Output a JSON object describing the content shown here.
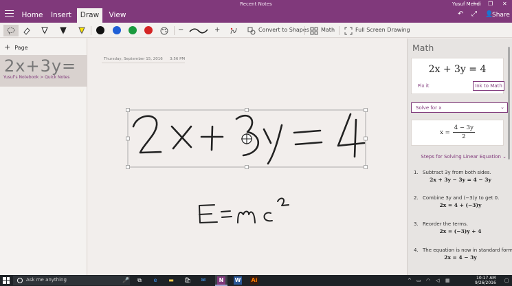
{
  "window": {
    "title": "Recent Notes",
    "user": "Yusuf Mehdi",
    "share_label": "Share",
    "share_icon": "person-share-icon"
  },
  "tabs": [
    {
      "label": "Home"
    },
    {
      "label": "Insert"
    },
    {
      "label": "Draw",
      "active": true
    },
    {
      "label": "View"
    }
  ],
  "ribbon": {
    "pen_colors": [
      "#111111",
      "#1f5fd6",
      "#1a9a3e",
      "#d42424"
    ],
    "convert_label": "Convert to Shapes",
    "math_label": "Math",
    "fullscreen_label": "Full Screen Drawing",
    "plus_icon": "+",
    "minus_icon": "−"
  },
  "pages": {
    "add_label": "Page",
    "items": [
      {
        "thumb": "2x+3y=",
        "path": "Yusuf's Notebook > Quick Notes"
      }
    ]
  },
  "note": {
    "date": "Thursday, September 15, 2016",
    "time": "3:56 PM"
  },
  "math_pane": {
    "title": "Math",
    "equation": "2x + 3y = 4",
    "fix_it": "Fix it",
    "ink_to_math": "Ink to Math",
    "action": "Solve for x",
    "solution_lhs": "x =",
    "solution_num": "4 − 3y",
    "solution_den": "2",
    "steps_label": "Steps for Solving Linear Equation",
    "steps": [
      {
        "n": "1.",
        "text": "Subtract 3y from both sides.",
        "result": "2x + 3y − 3y = 4 − 3y"
      },
      {
        "n": "2.",
        "text": "Combine 3y and (−3)y to get 0.",
        "result": "2x = 4 + (−3)y"
      },
      {
        "n": "3.",
        "text": "Reorder the terms.",
        "result": "2x = (−3)y + 4"
      },
      {
        "n": "4.",
        "text": "The equation is now in standard form.",
        "result": "2x = 4 − 3y"
      }
    ]
  },
  "taskbar": {
    "search_placeholder": "Ask me anything",
    "time": "10:17 AM",
    "date": "9/26/2016"
  }
}
